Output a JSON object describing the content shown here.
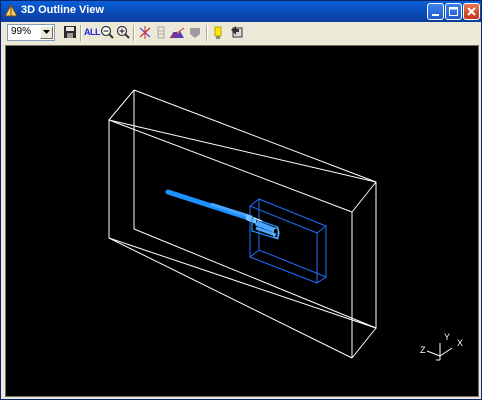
{
  "window": {
    "title": "3D Outline View"
  },
  "title_buttons": [
    {
      "name": "minimize-button",
      "icon": "minimize-icon"
    },
    {
      "name": "maximize-button",
      "icon": "maximize-icon"
    },
    {
      "name": "close-button",
      "icon": "close-icon"
    }
  ],
  "toolbar": {
    "zoom_value": "99%",
    "all_label": "ALL",
    "tools": [
      "save-icon",
      "zoom-all-icon",
      "zoom-out-icon",
      "zoom-in-icon",
      "axis-icon",
      "layers-icon",
      "mountain-icon",
      "shape-icon",
      "light-icon",
      "export-icon"
    ]
  },
  "viewport": {
    "background": "#000000",
    "outline_color": "#ffffff",
    "part_color": "#1e90ff",
    "axis_labels": {
      "x": "X",
      "y": "Y",
      "z": "Z"
    }
  }
}
